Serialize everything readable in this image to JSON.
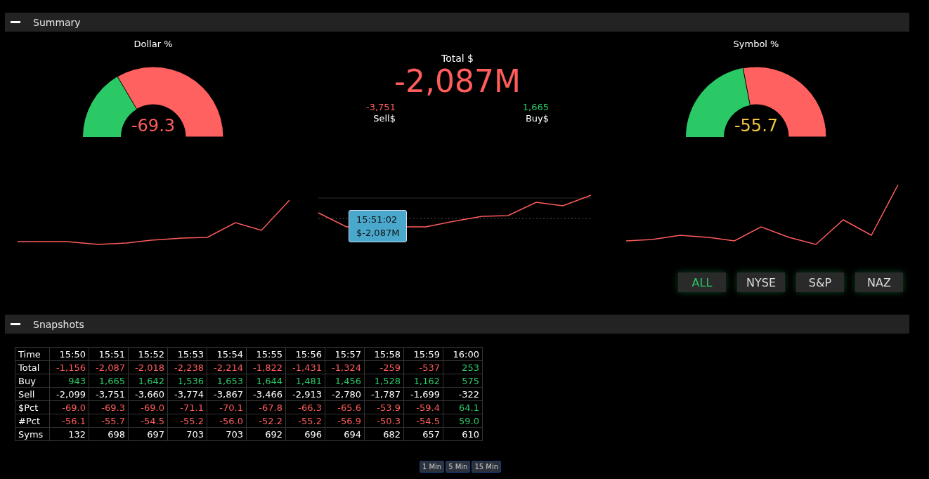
{
  "summary": {
    "title": "Summary",
    "dollar_gauge": {
      "title": "Dollar %",
      "value": "-69.3",
      "color": "#ff5c5c",
      "level": 0.33
    },
    "total": {
      "label": "Total $",
      "value": "-2,087M",
      "sell_value": "-3,751",
      "sell_label": "Sell$",
      "buy_value": "1,665",
      "buy_label": "Buy$"
    },
    "symbol_gauge": {
      "title": "Symbol %",
      "value": "-55.7",
      "color": "#f4c542",
      "level": 0.44
    },
    "tooltip": {
      "time": "15:51:02",
      "value": "$-2,087M"
    },
    "exchange_buttons": [
      {
        "label": "ALL",
        "selected": true
      },
      {
        "label": "NYSE",
        "selected": false
      },
      {
        "label": "S&P",
        "selected": false
      },
      {
        "label": "NAZ",
        "selected": false
      }
    ]
  },
  "snapshots": {
    "title": "Snapshots",
    "table": {
      "columns": [
        "Time",
        "15:50",
        "15:51",
        "15:52",
        "15:53",
        "15:54",
        "15:55",
        "15:56",
        "15:57",
        "15:58",
        "15:59",
        "16:00"
      ],
      "rows": [
        {
          "cells": [
            {
              "text": "Total"
            },
            {
              "text": "-1,156",
              "color": "#ff5c5c"
            },
            {
              "text": "-2,087",
              "color": "#ff5c5c"
            },
            {
              "text": "-2,018",
              "color": "#ff5c5c"
            },
            {
              "text": "-2,238",
              "color": "#ff5c5c"
            },
            {
              "text": "-2,214",
              "color": "#ff5c5c"
            },
            {
              "text": "-1,822",
              "color": "#ff5c5c"
            },
            {
              "text": "-1,431",
              "color": "#ff5c5c"
            },
            {
              "text": "-1,324",
              "color": "#ff5c5c"
            },
            {
              "text": "-259",
              "color": "#ff5c5c"
            },
            {
              "text": "-537",
              "color": "#ff5c5c"
            },
            {
              "text": "253",
              "color": "#2bc866"
            }
          ]
        },
        {
          "cells": [
            {
              "text": "Buy"
            },
            {
              "text": "943",
              "color": "#2bc866"
            },
            {
              "text": "1,665",
              "color": "#2bc866"
            },
            {
              "text": "1,642",
              "color": "#2bc866"
            },
            {
              "text": "1,536",
              "color": "#2bc866"
            },
            {
              "text": "1,653",
              "color": "#2bc866"
            },
            {
              "text": "1,644",
              "color": "#2bc866"
            },
            {
              "text": "1,481",
              "color": "#2bc866"
            },
            {
              "text": "1,456",
              "color": "#2bc866"
            },
            {
              "text": "1,528",
              "color": "#2bc866"
            },
            {
              "text": "1,162",
              "color": "#2bc866"
            },
            {
              "text": "575",
              "color": "#2bc866"
            }
          ]
        },
        {
          "cells": [
            {
              "text": "Sell"
            },
            {
              "text": "-2,099"
            },
            {
              "text": "-3,751"
            },
            {
              "text": "-3,660"
            },
            {
              "text": "-3,774"
            },
            {
              "text": "-3,867"
            },
            {
              "text": "-3,466"
            },
            {
              "text": "-2,913"
            },
            {
              "text": "-2,780"
            },
            {
              "text": "-1,787"
            },
            {
              "text": "-1,699"
            },
            {
              "text": "-322"
            }
          ]
        },
        {
          "cells": [
            {
              "text": "$Pct"
            },
            {
              "text": "-69.0",
              "color": "#ff5c5c"
            },
            {
              "text": "-69.3",
              "color": "#ff5c5c"
            },
            {
              "text": "-69.0",
              "color": "#ff5c5c"
            },
            {
              "text": "-71.1",
              "color": "#ff5c5c"
            },
            {
              "text": "-70.1",
              "color": "#ff5c5c"
            },
            {
              "text": "-67.8",
              "color": "#ff5c5c"
            },
            {
              "text": "-66.3",
              "color": "#ff5c5c"
            },
            {
              "text": "-65.6",
              "color": "#ff5c5c"
            },
            {
              "text": "-53.9",
              "color": "#ff5c5c"
            },
            {
              "text": "-59.4",
              "color": "#ff5c5c"
            },
            {
              "text": "64.1",
              "color": "#2bc866"
            }
          ]
        },
        {
          "cells": [
            {
              "text": "#Pct"
            },
            {
              "text": "-56.1",
              "color": "#ff5c5c"
            },
            {
              "text": "-55.7",
              "color": "#ff5c5c"
            },
            {
              "text": "-54.5",
              "color": "#ff5c5c"
            },
            {
              "text": "-55.2",
              "color": "#ff5c5c"
            },
            {
              "text": "-56.0",
              "color": "#ff5c5c"
            },
            {
              "text": "-52.2",
              "color": "#ff5c5c"
            },
            {
              "text": "-55.2",
              "color": "#ff5c5c"
            },
            {
              "text": "-56.9",
              "color": "#ff5c5c"
            },
            {
              "text": "-50.3",
              "color": "#ff5c5c"
            },
            {
              "text": "-54.5",
              "color": "#ff5c5c"
            },
            {
              "text": "59.0",
              "color": "#2bc866"
            }
          ]
        },
        {
          "cells": [
            {
              "text": "Syms"
            },
            {
              "text": "132"
            },
            {
              "text": "698"
            },
            {
              "text": "697"
            },
            {
              "text": "703"
            },
            {
              "text": "703"
            },
            {
              "text": "692"
            },
            {
              "text": "696"
            },
            {
              "text": "694"
            },
            {
              "text": "682"
            },
            {
              "text": "657"
            },
            {
              "text": "610"
            }
          ]
        }
      ]
    },
    "interval_buttons": [
      {
        "label": "1 Min"
      },
      {
        "label": "5 Min"
      },
      {
        "label": "15 Min"
      }
    ]
  }
}
